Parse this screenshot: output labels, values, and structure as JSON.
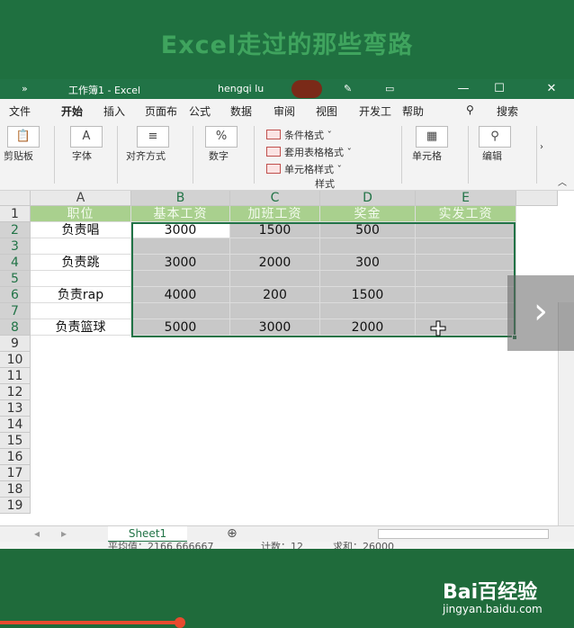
{
  "banner": {
    "title": "Excel走过的那些弯路"
  },
  "titlebar": {
    "chevrons": "»",
    "doc_title": "工作簿1  -  Excel",
    "user": "hengqi lu",
    "minimize": "—",
    "restore": "☐",
    "close": "✕"
  },
  "menu": {
    "items": [
      "文件",
      "开始",
      "插入",
      "页面布",
      "公式",
      "数据",
      "审阅",
      "视图",
      "开发工",
      "帮助"
    ],
    "active_index": 1,
    "search_label": "搜索"
  },
  "ribbon": {
    "clipboard": "剪贴板",
    "font": "字体",
    "alignment": "对齐方式",
    "number": "数字",
    "conditional_format": "条件格式 ˇ",
    "table_format": "套用表格格式 ˇ",
    "cell_styles": "单元格样式 ˇ",
    "styles_group": "样式",
    "cells": "单元格",
    "editing": "编辑",
    "percent_symbol": "%"
  },
  "sheet": {
    "columns": [
      "A",
      "B",
      "C",
      "D",
      "E"
    ],
    "rows": [
      "1",
      "2",
      "3",
      "4",
      "5",
      "6",
      "7",
      "8",
      "9",
      "10",
      "11",
      "12",
      "13",
      "14",
      "15",
      "16",
      "17",
      "18",
      "19"
    ],
    "header_row": [
      "职位",
      "基本工资",
      "加班工资",
      "奖金",
      "实发工资"
    ],
    "data": [
      {
        "row": "2",
        "name": "负责唱",
        "base": "3000",
        "overtime": "1500",
        "bonus": "500"
      },
      {
        "row": "4",
        "name": "负责跳",
        "base": "3000",
        "overtime": "2000",
        "bonus": "300"
      },
      {
        "row": "6",
        "name": "负责rap",
        "base": "4000",
        "overtime": "200",
        "bonus": "1500"
      },
      {
        "row": "8",
        "name": "负责篮球",
        "base": "5000",
        "overtime": "3000",
        "bonus": "2000"
      }
    ]
  },
  "sheetbar": {
    "tab": "Sheet1",
    "add": "⊕"
  },
  "statusbar": {
    "average": "平均值：2166.666667",
    "count": "计数：12",
    "sum": "求和：26000"
  },
  "watermark": {
    "brand": "Bai百经验",
    "site": "jingyan.baidu.com"
  },
  "colors": {
    "excel_green": "#217346",
    "header_fill": "#a9d08e",
    "selection_fill": "#c8c8c8"
  }
}
